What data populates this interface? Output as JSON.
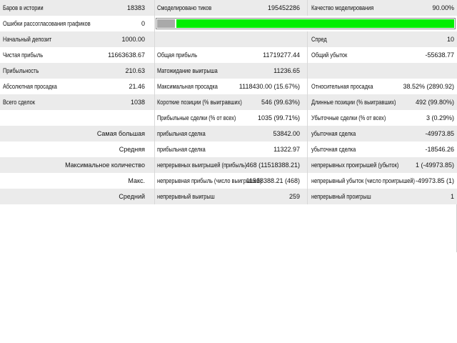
{
  "report": {
    "bars_label": "Баров в истории",
    "bars_value": "18383",
    "ticks_label": "Смоделировано тиков",
    "ticks_value": "195452286",
    "quality_label": "Качество моделирования",
    "quality_value": "90.00%",
    "mismatch_label": "Ошибки рассогласования графиков",
    "mismatch_value": "0",
    "quality_bar": {
      "fill_fraction": 0.94,
      "fill_color": "#00ee00",
      "empty_color": "#a9a9a9"
    },
    "deposit_label": "Начальный депозит",
    "deposit_value": "1000.00",
    "spread_label": "Спред",
    "spread_value": "10",
    "net_profit_label": "Чистая прибыль",
    "net_profit_value": "11663638.67",
    "gross_profit_label": "Общая прибыль",
    "gross_profit_value": "11719277.44",
    "gross_loss_label": "Общий убыток",
    "gross_loss_value": "-55638.77",
    "profit_factor_label": "Прибыльность",
    "profit_factor_value": "210.63",
    "expected_payoff_label": "Матожидание выигрыша",
    "expected_payoff_value": "11236.65",
    "abs_dd_label": "Абсолютная просадка",
    "abs_dd_value": "21.46",
    "max_dd_label": "Максимальная просадка",
    "max_dd_value": "1118430.00 (15.67%)",
    "rel_dd_label": "Относительная просадка",
    "rel_dd_value": "38.52% (2890.92)",
    "total_trades_label": "Всего сделок",
    "total_trades_value": "1038",
    "short_label": "Короткие позиции (% выигравших)",
    "short_value": "546 (99.63%)",
    "long_label": "Длинные позиции (% выигравших)",
    "long_value": "492 (99.80%)",
    "win_trades_label": "Прибыльные сделки (% от всех)",
    "win_trades_value": "1035 (99.71%)",
    "loss_trades_label": "Убыточные сделки (% от всех)",
    "loss_trades_value": "3 (0.29%)",
    "largest_label": "Самая большая",
    "largest_profit_label": "прибыльная сделка",
    "largest_profit_value": "53842.00",
    "largest_loss_label": "убыточная сделка",
    "largest_loss_value": "-49973.85",
    "average_label": "Средняя",
    "avg_profit_label": "прибыльная сделка",
    "avg_profit_value": "11322.97",
    "avg_loss_label": "убыточная сделка",
    "avg_loss_value": "-18546.26",
    "max_count_label": "Максимальное количество",
    "max_cons_wins_label": "непрерывных выигрышей (прибыль)",
    "max_cons_wins_value": "468 (11518388.21)",
    "max_cons_losses_label": "непрерывных проигрышей (убыток)",
    "max_cons_losses_value": "1 (-49973.85)",
    "max_label": "Макс.",
    "max_cons_profit_label": "непрерывная прибыль (число выигрышей)",
    "max_cons_profit_value": "11518388.21 (468)",
    "max_cons_loss_label": "непрерывный убыток (число проигрышей)",
    "max_cons_loss_value": "-49973.85 (1)",
    "avg_cons_label": "Средний",
    "avg_cons_wins_label": "непрерывный выигрыш",
    "avg_cons_wins_value": "259",
    "avg_cons_losses_label": "непрерывный проигрыш",
    "avg_cons_losses_value": "1"
  }
}
